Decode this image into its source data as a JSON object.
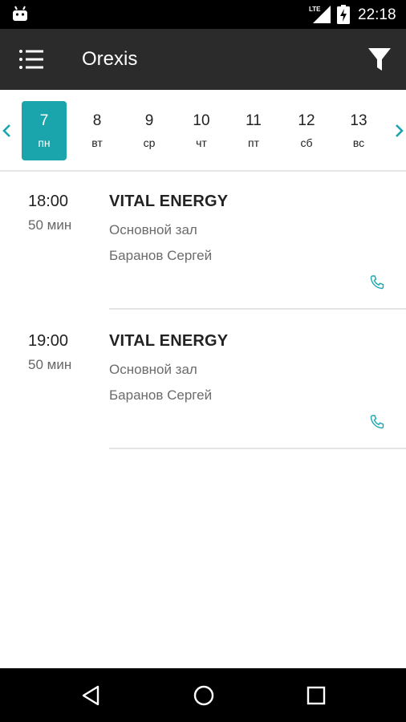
{
  "status_bar": {
    "network": "LTE",
    "time": "22:18",
    "icons": [
      "android-icon",
      "signal-icon",
      "battery-charging-icon"
    ]
  },
  "app_bar": {
    "title": "Orexis",
    "icons": [
      "menu-icon",
      "filter-icon"
    ]
  },
  "date_strip": {
    "days": [
      {
        "num": "7",
        "name": "пн",
        "selected": true
      },
      {
        "num": "8",
        "name": "вт",
        "selected": false
      },
      {
        "num": "9",
        "name": "ср",
        "selected": false
      },
      {
        "num": "10",
        "name": "чт",
        "selected": false
      },
      {
        "num": "11",
        "name": "пт",
        "selected": false
      },
      {
        "num": "12",
        "name": "сб",
        "selected": false
      },
      {
        "num": "13",
        "name": "вс",
        "selected": false
      }
    ],
    "icons": [
      "chevron-left-icon",
      "chevron-right-icon"
    ]
  },
  "sessions": [
    {
      "time": "18:00",
      "duration": "50 мин",
      "name": "VITAL ENERGY",
      "room": "Основной зал",
      "trainer": "Баранов Сергей"
    },
    {
      "time": "19:00",
      "duration": "50 мин",
      "name": "VITAL ENERGY",
      "room": "Основной зал",
      "trainer": "Баранов Сергей"
    }
  ],
  "nav_bar": {
    "icons": [
      "back-icon",
      "home-icon",
      "recents-icon"
    ]
  },
  "colors": {
    "accent": "#1aa5ad",
    "app_bar": "#2b2b2b",
    "system_bars": "#000000"
  }
}
